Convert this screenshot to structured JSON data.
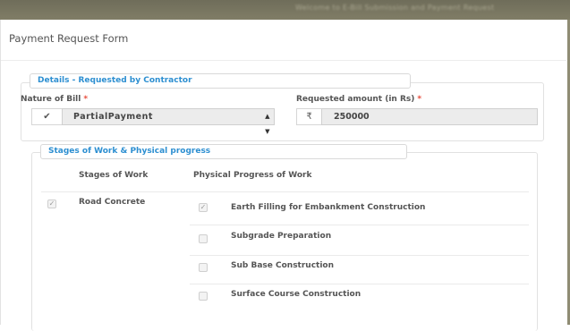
{
  "background_banner": {
    "text": "Welcome to E-Bill Submission and Payment Request"
  },
  "modal": {
    "title": "Payment Request Form"
  },
  "details_section": {
    "legend": "Details - Requested by Contractor",
    "nature_of_bill": {
      "label": "Nature of Bill",
      "required_mark": "*",
      "addon_icon": "checkmark-icon",
      "selected_value": "PartialPayment"
    },
    "requested_amount": {
      "label": "Requested amount (in Rs)",
      "required_mark": "*",
      "currency_symbol": "₹",
      "value": "250000"
    }
  },
  "stages_section": {
    "legend": "Stages of Work & Physical progress",
    "columns": [
      "Stages of Work",
      "Physical Progress of Work"
    ],
    "stage": {
      "name": "Road Concrete",
      "checked": true
    },
    "progress_items": [
      {
        "label": "Earth Filling for Embankment Construction",
        "checked": true
      },
      {
        "label": "Subgrade Preparation",
        "checked": false
      },
      {
        "label": "Sub Base Construction",
        "checked": false
      },
      {
        "label": "Surface Course Construction",
        "checked": false
      }
    ]
  },
  "colors": {
    "accent": "#2d8fd1",
    "required": "#e74c3c",
    "banner": "#7a7761"
  }
}
